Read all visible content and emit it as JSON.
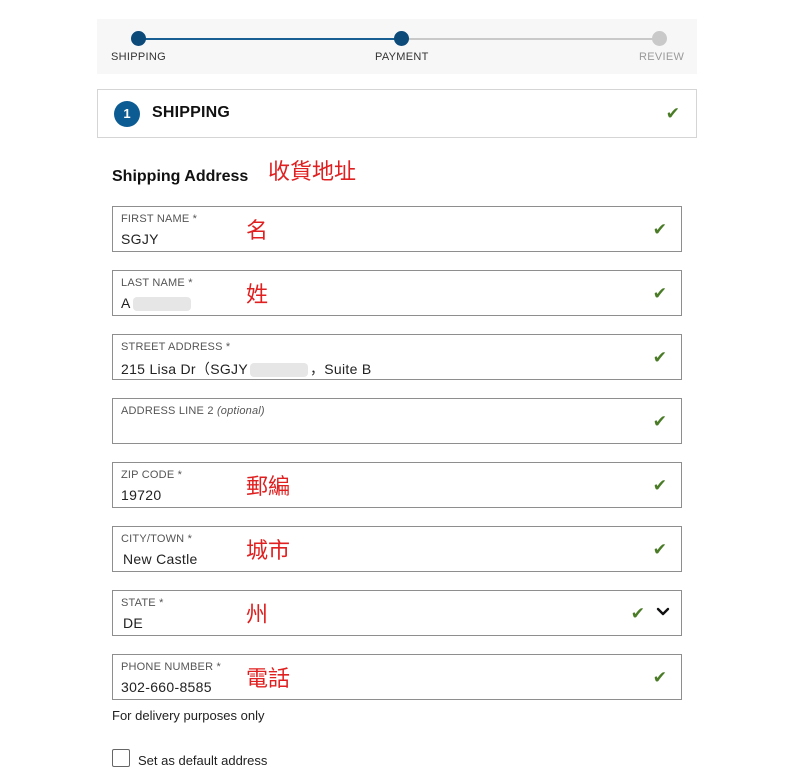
{
  "stepper": {
    "steps": [
      {
        "label": "SHIPPING",
        "state": "active"
      },
      {
        "label": "PAYMENT",
        "state": "active"
      },
      {
        "label": "REVIEW",
        "state": "inactive"
      }
    ]
  },
  "section": {
    "number": "1",
    "title": "SHIPPING",
    "status_icon": "check-icon"
  },
  "address": {
    "title": "Shipping Address",
    "annotation": "收貨地址"
  },
  "fields": {
    "first_name": {
      "label": "FIRST NAME *",
      "value": "SGJY",
      "annotation": "名"
    },
    "last_name": {
      "label": "LAST NAME *",
      "value": "A",
      "annotation": "姓"
    },
    "street": {
      "label": "STREET ADDRESS *",
      "value_prefix": "215 Lisa Dr（SGJY",
      "value_suffix": "，Suite  B"
    },
    "address2": {
      "label": "ADDRESS LINE 2",
      "optional": "(optional)",
      "value": ""
    },
    "zip": {
      "label": "ZIP CODE *",
      "value": "19720",
      "annotation": "郵編"
    },
    "city": {
      "label": "CITY/TOWN *",
      "value": "New Castle",
      "annotation": "城市"
    },
    "state": {
      "label": "STATE *",
      "value": "DE",
      "annotation": "州"
    },
    "phone": {
      "label": "PHONE NUMBER *",
      "value": "302-660-8585",
      "annotation": "電話"
    }
  },
  "helper_text": "For delivery purposes only",
  "default_address": {
    "label": "Set as default address",
    "checked": false
  },
  "colors": {
    "accent": "#0c5b93",
    "progress": "#1a5f93",
    "check": "#4a7c27",
    "annotation": "#e02020"
  }
}
